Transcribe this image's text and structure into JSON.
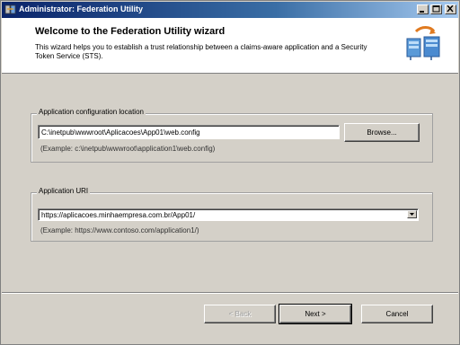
{
  "window": {
    "title": "Administrator: Federation Utility"
  },
  "header": {
    "title": "Welcome to the Federation Utility wizard",
    "description": "This wizard helps you to establish a trust relationship between a claims-aware application and a Security Token Service (STS)."
  },
  "config_group": {
    "label": "Application configuration location",
    "value": "C:\\inetpub\\wwwroot\\Aplicacoes\\App01\\web.config",
    "browse_label": "Browse...",
    "example": "(Example: c:\\inetpub\\wwwroot\\application1\\web.config)"
  },
  "uri_group": {
    "label": "Application URI",
    "value": "https://aplicacoes.minhaempresa.com.br/App01/",
    "example": "(Example: https://www.contoso.com/application1/)"
  },
  "footer": {
    "back_label": "< Back",
    "next_label": "Next >",
    "cancel_label": "Cancel"
  },
  "colors": {
    "titlebar_start": "#0a246a",
    "titlebar_end": "#a6caf0",
    "dialog_bg": "#d4d0c8"
  }
}
